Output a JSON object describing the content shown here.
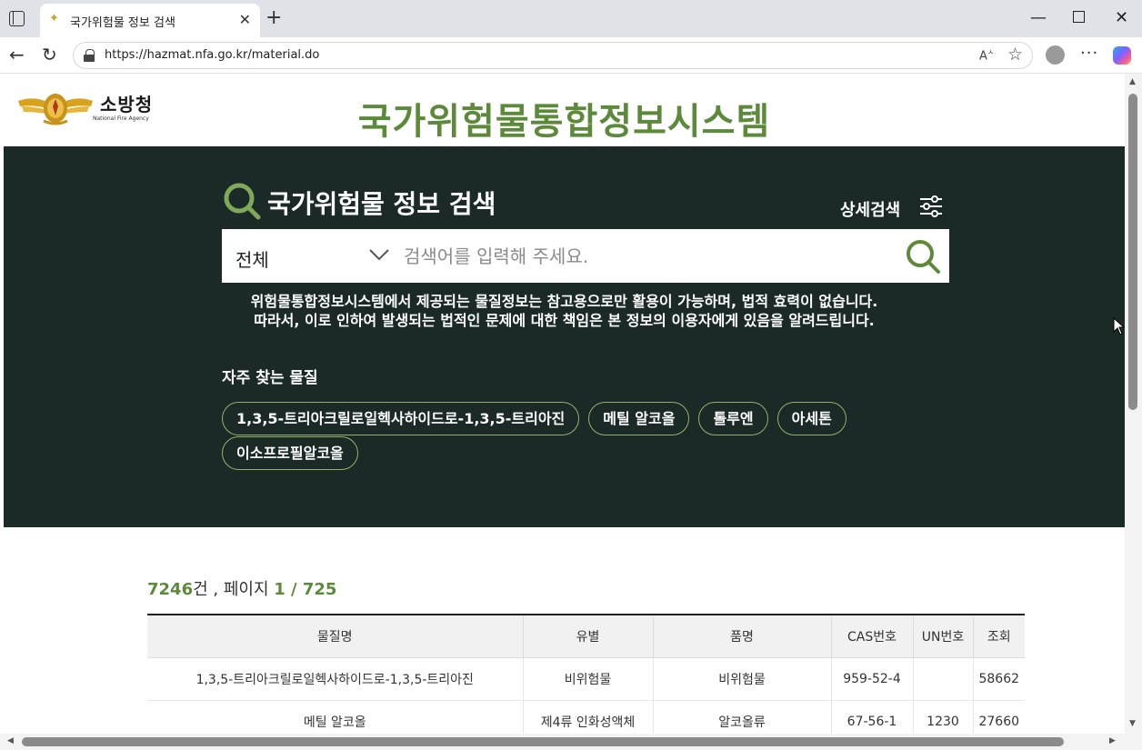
{
  "browser": {
    "tab_title": "국가위험물 정보 검색",
    "url": "https://hazmat.nfa.go.kr/material.do"
  },
  "header": {
    "logo_name": "소방청",
    "logo_sub": "National Fire Agency",
    "site_title": "국가위험물통합정보시스템"
  },
  "search": {
    "title": "국가위험물 정보 검색",
    "advanced_label": "상세검색",
    "category_selected": "전체",
    "placeholder": "검색어를 입력해 주세요.",
    "notice_line1": "위험물통합정보시스템에서 제공되는 물질정보는 참고용으로만 활용이 가능하며, 법적 효력이 없습니다.",
    "notice_line2": "따라서, 이로 인하여 발생되는 법적인 문제에 대한 책임은 본 정보의 이용자에게 있음을 알려드립니다."
  },
  "frequent": {
    "label": "자주 찾는 물질",
    "chips": [
      "1,3,5-트리아크릴로일헥사하이드로-1,3,5-트리아진",
      "메틸 알코올",
      "톨루엔",
      "아세톤",
      "이소프로필알코올"
    ]
  },
  "results": {
    "count": "7246",
    "count_unit": "건 , 페이지 ",
    "page": "1 / 725",
    "headers": [
      "물질명",
      "유별",
      "품명",
      "CAS번호",
      "UN번호",
      "조회"
    ],
    "rows": [
      [
        "1,3,5-트리아크릴로일헥사하이드로-1,3,5-트리아진",
        "비위험물",
        "비위험물",
        "959-52-4",
        "",
        "58662"
      ],
      [
        "메틸 알코올",
        "제4류 인화성액체",
        "알코올류",
        "67-56-1",
        "1230",
        "27660"
      ]
    ]
  },
  "colors": {
    "accent_green": "#5c8a3a",
    "hero_bg": "#1b2a26"
  }
}
